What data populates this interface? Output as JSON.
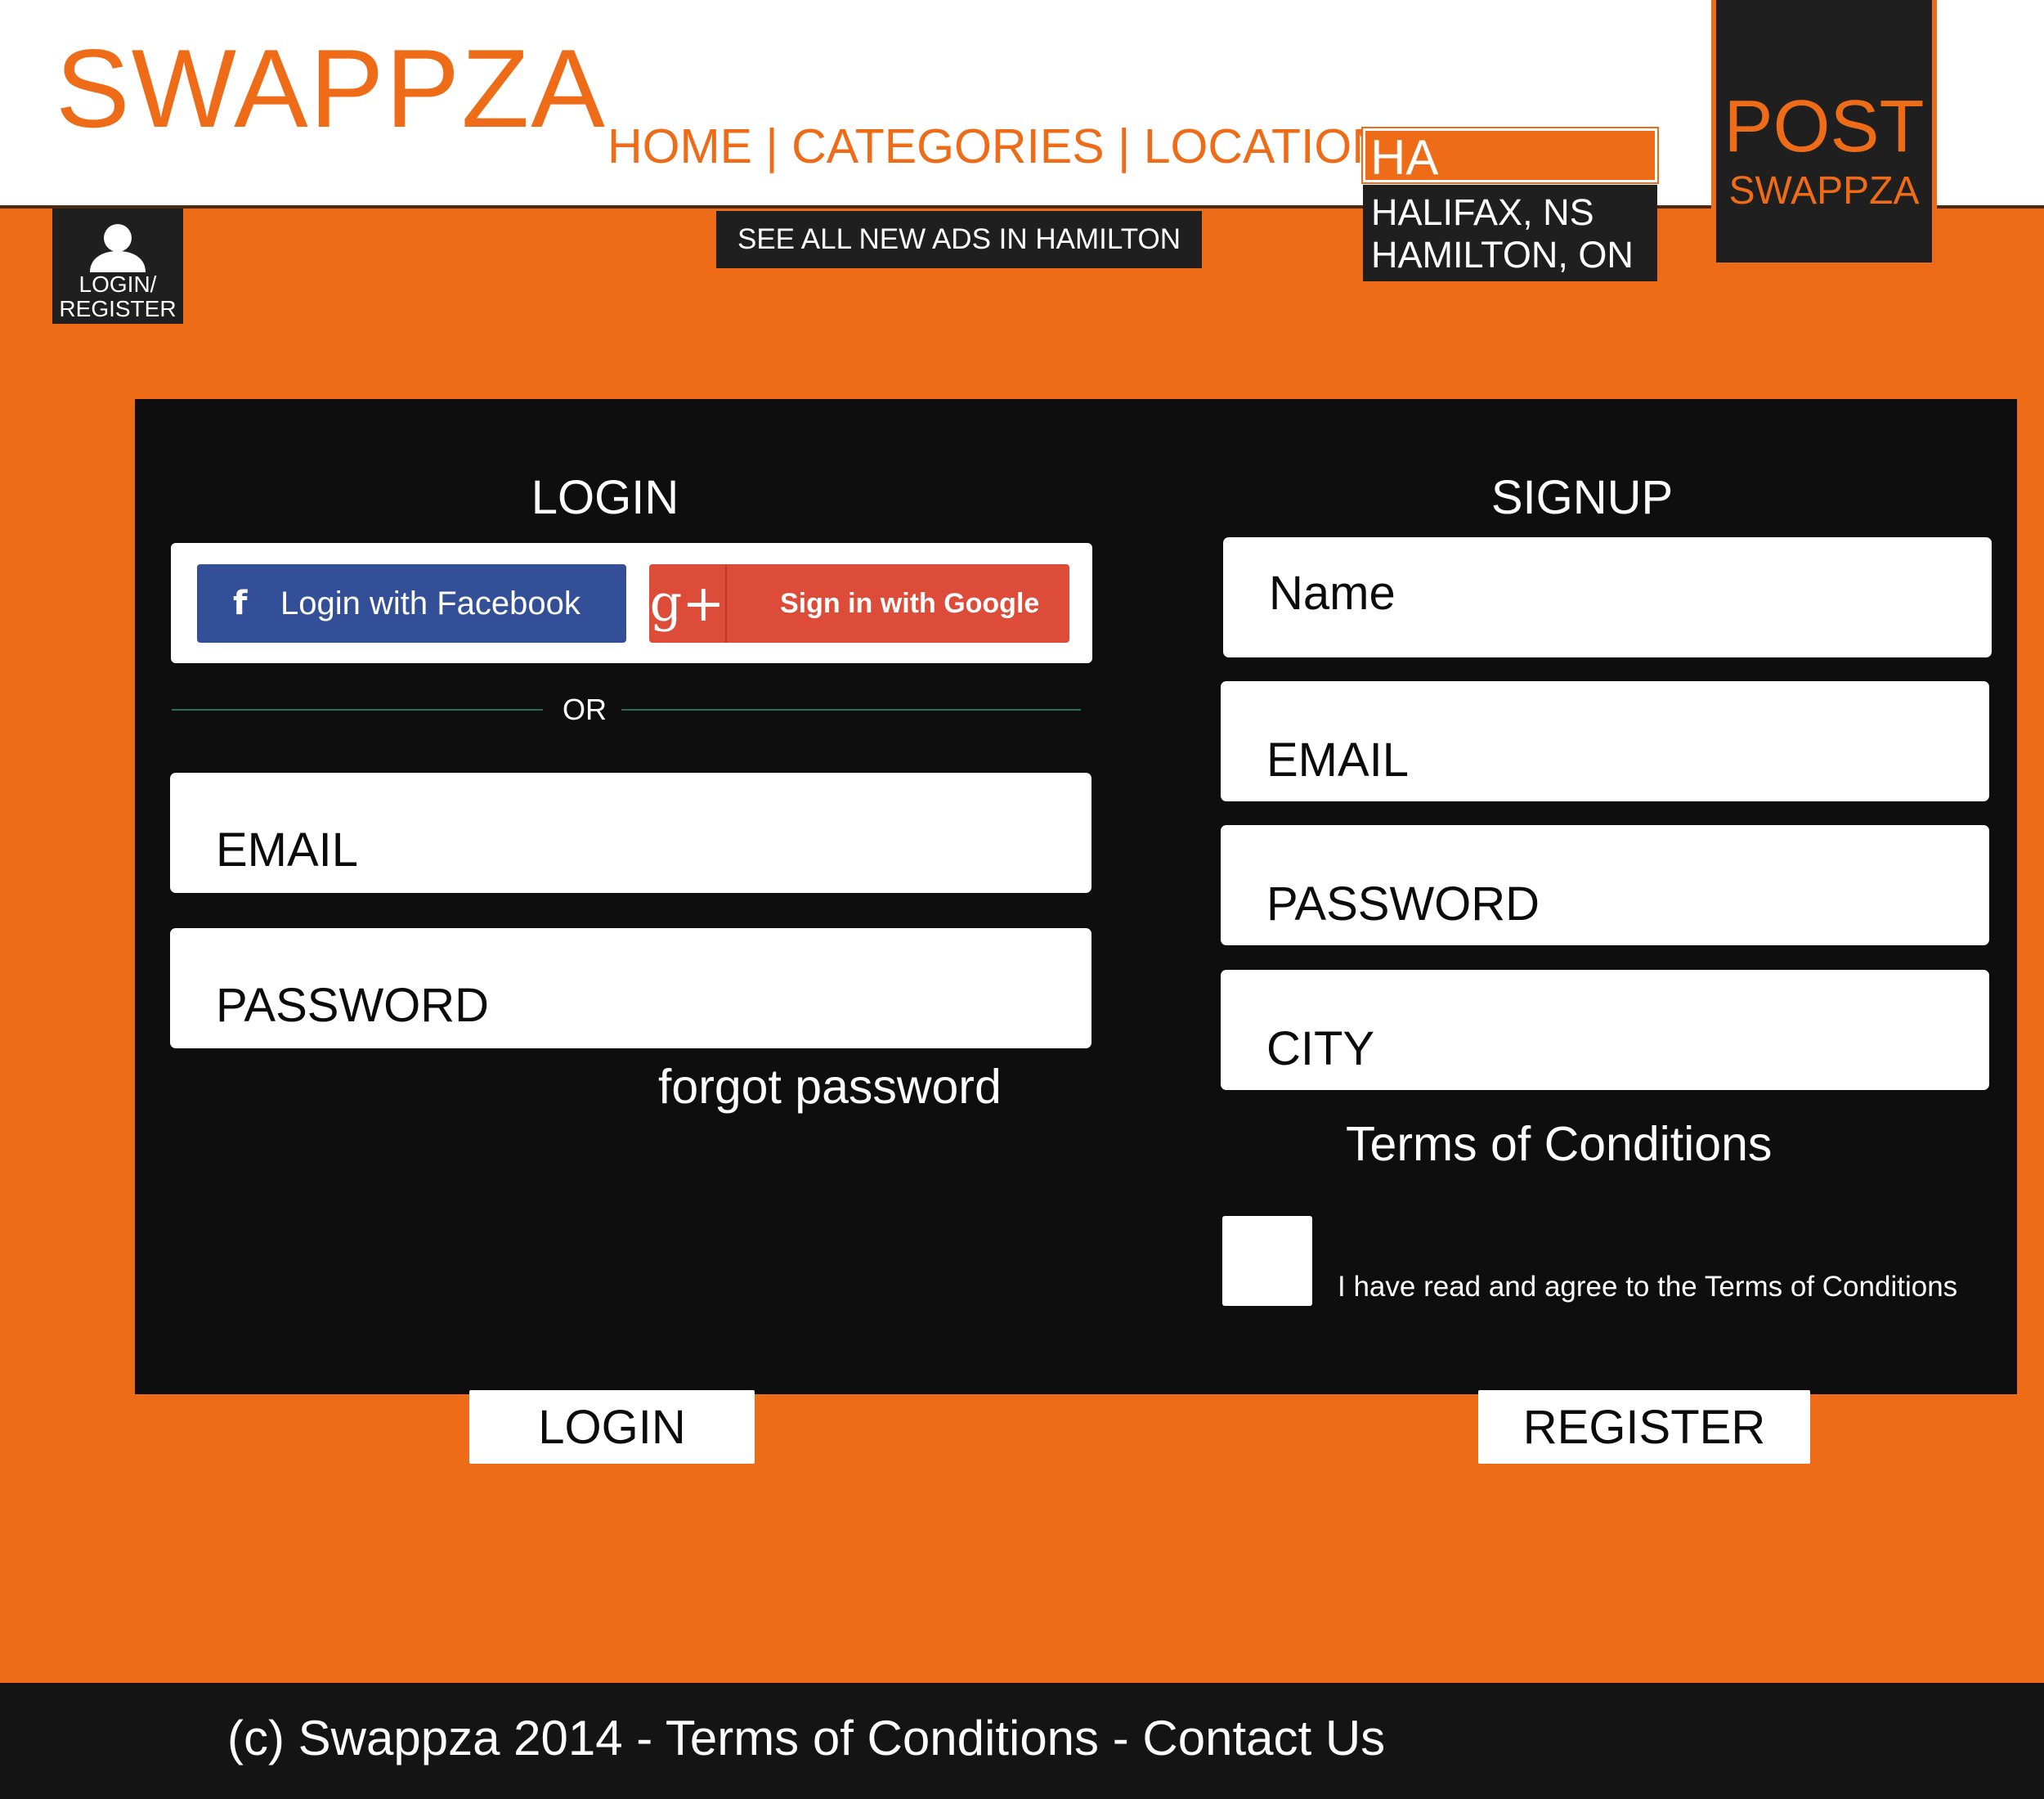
{
  "brand": {
    "name": "SWAPPZA",
    "accent_color": "#ee6c17",
    "dark_color": "#1f1f1f"
  },
  "nav": {
    "home": "HOME",
    "categories": "CATEGORIES",
    "location_label": "LOCATION:",
    "separator": " | ",
    "location_value": "HA",
    "location_suggestions": [
      "HALIFAX, NS",
      "HAMILTON, ON"
    ]
  },
  "post_button": {
    "main": "POST",
    "sub": "SWAPPZA"
  },
  "account_chip": {
    "icon": "user-icon",
    "label_line1": "LOGIN/",
    "label_line2": "REGISTER"
  },
  "see_all_ads": "SEE ALL NEW ADS IN HAMILTON",
  "login": {
    "title": "LOGIN",
    "facebook_button": "Login with Facebook",
    "facebook_icon": "f",
    "google_button": "Sign in with Google",
    "google_icon": "g+",
    "or_text": "OR",
    "email_placeholder": "EMAIL",
    "password_placeholder": "PASSWORD",
    "forgot_password": "forgot password",
    "submit_label": "LOGIN"
  },
  "signup": {
    "title": "SIGNUP",
    "name_placeholder": "Name",
    "email_placeholder": "EMAIL",
    "password_placeholder": "PASSWORD",
    "city_placeholder": "CITY",
    "terms_heading": "Terms of Conditions",
    "agree_label": "I have read and agree to the Terms of Conditions",
    "agree_checked": false,
    "submit_label": "REGISTER"
  },
  "footer": {
    "text": "(c) Swappza 2014 - Terms of Conditions - Contact Us"
  }
}
